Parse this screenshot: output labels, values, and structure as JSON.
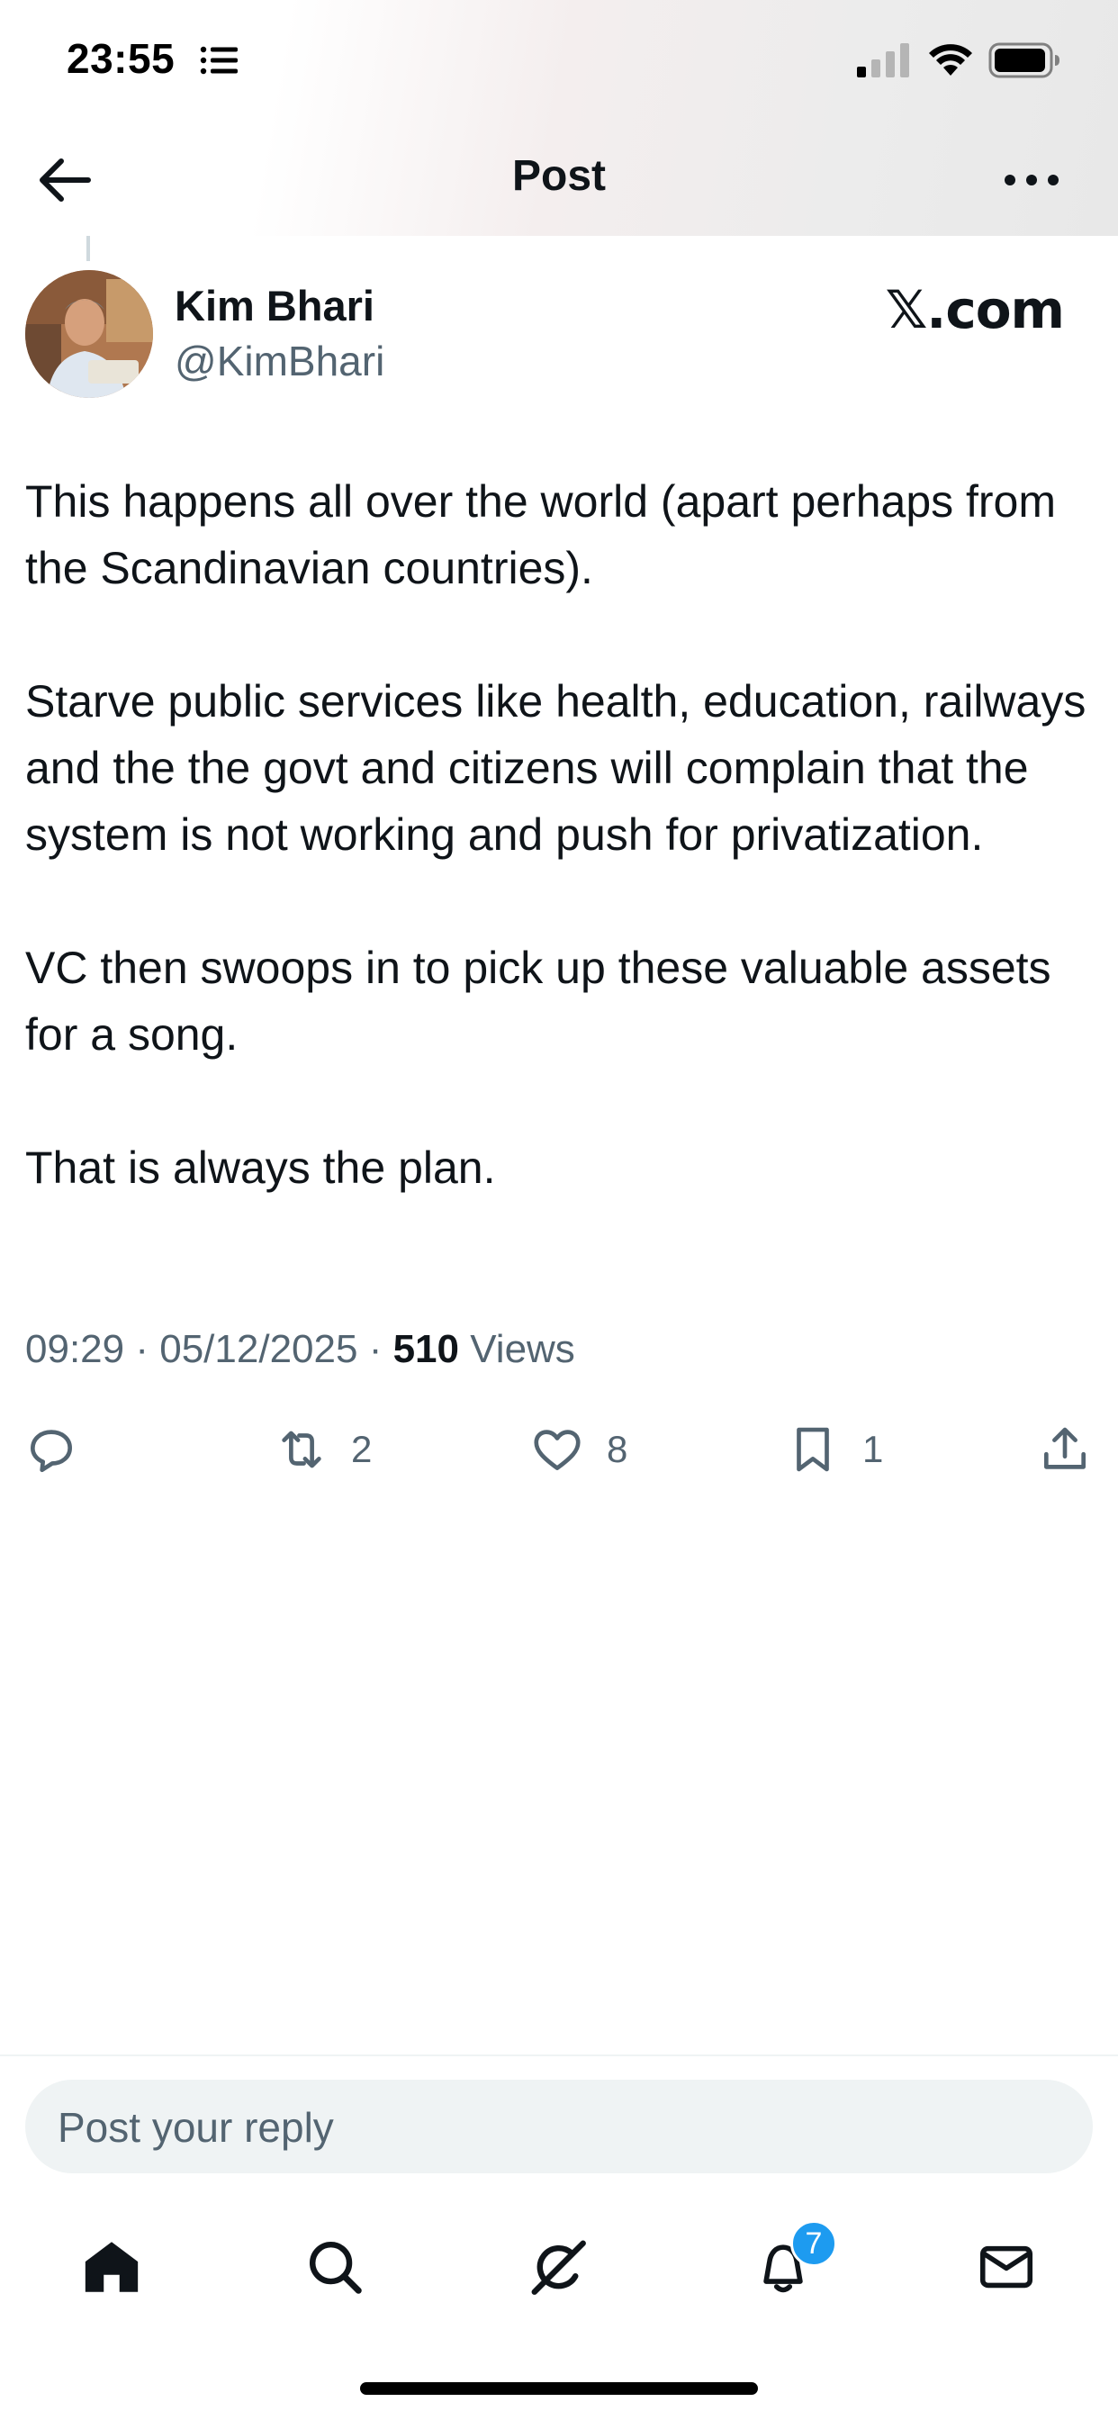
{
  "status_bar": {
    "time": "23:55"
  },
  "header": {
    "title": "Post"
  },
  "post": {
    "author_name": "Kim Bhari",
    "author_handle": "@KimBhari",
    "source": "𝕏.com",
    "paragraphs": [
      "This happens all over the world (apart perhaps from the Scandinavian countries).",
      "Starve public services like health, education, railways and the the govt and citizens will complain that the system is not working and push for privatization.",
      "VC then swoops in to pick up these valuable assets for a song.",
      "That is always the plan."
    ],
    "time": "09:29",
    "date": "05/12/2025",
    "views_count": "510",
    "views_label": "Views",
    "separator": "·"
  },
  "actions": {
    "reply_icon": "reply-icon",
    "repost_count": "2",
    "like_count": "8",
    "bookmark_count": "1"
  },
  "reply": {
    "placeholder": "Post your reply"
  },
  "tabs": {
    "notifications_badge": "7"
  }
}
